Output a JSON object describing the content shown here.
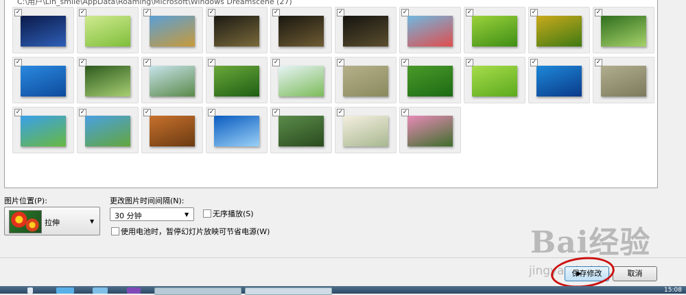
{
  "path_text": "C:\\用户\\Lin_smile\\AppData\\Roaming\\Microsoft\\Windows Dreamscene (27)",
  "thumbnails": [
    {
      "colors": [
        "#0b1a4a",
        "#2e5fb7"
      ],
      "checked": "✓"
    },
    {
      "colors": [
        "#cfe98f",
        "#7fbf3a"
      ],
      "checked": "✓"
    },
    {
      "colors": [
        "#5a9fd6",
        "#c89a3a"
      ],
      "checked": "✓"
    },
    {
      "colors": [
        "#1c1a14",
        "#7a6a3a"
      ],
      "checked": "✓"
    },
    {
      "colors": [
        "#1a1710",
        "#6e5c33"
      ],
      "checked": "✓"
    },
    {
      "colors": [
        "#151410",
        "#5b4e2e"
      ],
      "checked": "✓"
    },
    {
      "colors": [
        "#6fb8e0",
        "#e04d4d"
      ],
      "checked": "✓"
    },
    {
      "colors": [
        "#9ad13a",
        "#3f8e16"
      ],
      "checked": "✓"
    },
    {
      "colors": [
        "#caa91c",
        "#3e7a12"
      ],
      "checked": "✓"
    },
    {
      "colors": [
        "#2f6e1e",
        "#a6d26a"
      ],
      "checked": "✓"
    },
    {
      "colors": [
        "#2a8ae0",
        "#0d4a9c"
      ],
      "checked": "✓"
    },
    {
      "colors": [
        "#2c5a1e",
        "#a8cf73"
      ],
      "checked": "✓"
    },
    {
      "colors": [
        "#c7e3ea",
        "#5a8a4a"
      ],
      "checked": "✓"
    },
    {
      "colors": [
        "#6aa83a",
        "#1f5e14"
      ],
      "checked": "✓"
    },
    {
      "colors": [
        "#e7f3f6",
        "#7cbc5a"
      ],
      "checked": "✓"
    },
    {
      "colors": [
        "#b5b08a",
        "#8a8a5e"
      ],
      "checked": "✓"
    },
    {
      "colors": [
        "#4a9a2a",
        "#1c6a14"
      ],
      "checked": "✓"
    },
    {
      "colors": [
        "#a6dc4a",
        "#5caa1e"
      ],
      "checked": "✓"
    },
    {
      "colors": [
        "#1e88d8",
        "#0a3a8a"
      ],
      "checked": "✓"
    },
    {
      "colors": [
        "#b0ae8e",
        "#7c7a5c"
      ],
      "checked": "✓"
    },
    {
      "colors": [
        "#3aa0ea",
        "#68b840"
      ],
      "checked": "✓"
    },
    {
      "colors": [
        "#4aa0e2",
        "#63a63c"
      ],
      "checked": "✓"
    },
    {
      "colors": [
        "#c8712c",
        "#6a3a12"
      ],
      "checked": "✓"
    },
    {
      "colors": [
        "#0a5cc0",
        "#9ad0f6"
      ],
      "checked": "✓"
    },
    {
      "colors": [
        "#5a8c4a",
        "#2a4a1e"
      ],
      "checked": "✓"
    },
    {
      "colors": [
        "#f4efe0",
        "#a8b890"
      ],
      "checked": "✓"
    },
    {
      "colors": [
        "#e88ab8",
        "#3e6e2a"
      ],
      "checked": "✓"
    }
  ],
  "position": {
    "label": "图片位置(P):",
    "value": "拉伸"
  },
  "interval": {
    "label": "更改图片时间间隔(N):",
    "value": "30 分钟"
  },
  "shuffle": {
    "label": "无序播放(S)"
  },
  "battery": {
    "label": "使用电池时，暂停幻灯片放映可节省电源(W)"
  },
  "buttons": {
    "save": "保存修改",
    "cancel": "取消"
  },
  "watermark": {
    "brand": "Bai经验",
    "url": "jingyan.baidu.com"
  },
  "clock": "15:08"
}
